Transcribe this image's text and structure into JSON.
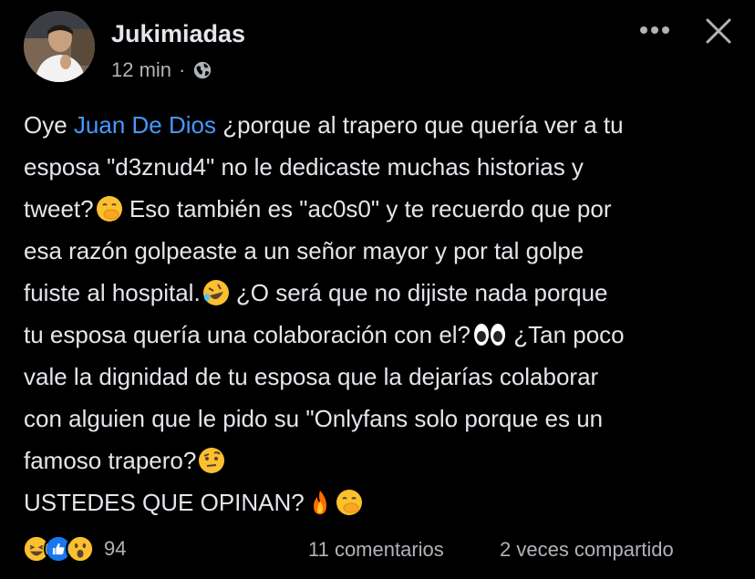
{
  "post": {
    "author": "Jukimiadas",
    "time": "12 min",
    "separator": "·",
    "privacy_icon": "globe-icon",
    "menu_icon": "more-dots-icon",
    "close_icon": "close-icon"
  },
  "body": {
    "l1_pre": "Oye ",
    "l1_mention": "Juan De Dios",
    "l1_post": " ¿porque al trapero que quería ver a tu",
    "l2": "esposa \"d3znud4\" no le dedicaste muchas historias y",
    "l3_pre": "tweet?",
    "l3_post": " Eso también es \"ac0s0\" y te recuerdo que por",
    "l4": "esa razón golpeaste a un señor mayor y por tal golpe",
    "l5_pre": "fuiste al hospital.",
    "l5_post": " ¿O será que no dijiste nada porque",
    "l6_pre": "tu esposa quería una colaboración con el?",
    "l6_post": " ¿Tan poco",
    "l7": "vale la dignidad de tu esposa que la dejarías colaborar",
    "l8": "con alguien que le pido su \"Onlyfans solo porque es un",
    "l9": "famoso trapero?",
    "l10": "USTEDES QUE OPINAN?"
  },
  "emojis": [
    "hand-over-mouth-emoji",
    "rolling-laughing-emoji",
    "eyes-emoji",
    "raised-eyebrow-emoji",
    "fire-emoji",
    "hand-over-mouth-emoji"
  ],
  "footer": {
    "reaction_icons": [
      "haha-reaction-icon",
      "like-reaction-icon",
      "wow-reaction-icon"
    ],
    "reaction_count": "94",
    "comments": "11 comentarios",
    "shares": "2 veces compartido"
  },
  "colors": {
    "background": "#000000",
    "text": "#e4e6eb",
    "secondary": "#b0b3b8",
    "mention": "#4599ff",
    "like_blue": "#1877f2"
  }
}
